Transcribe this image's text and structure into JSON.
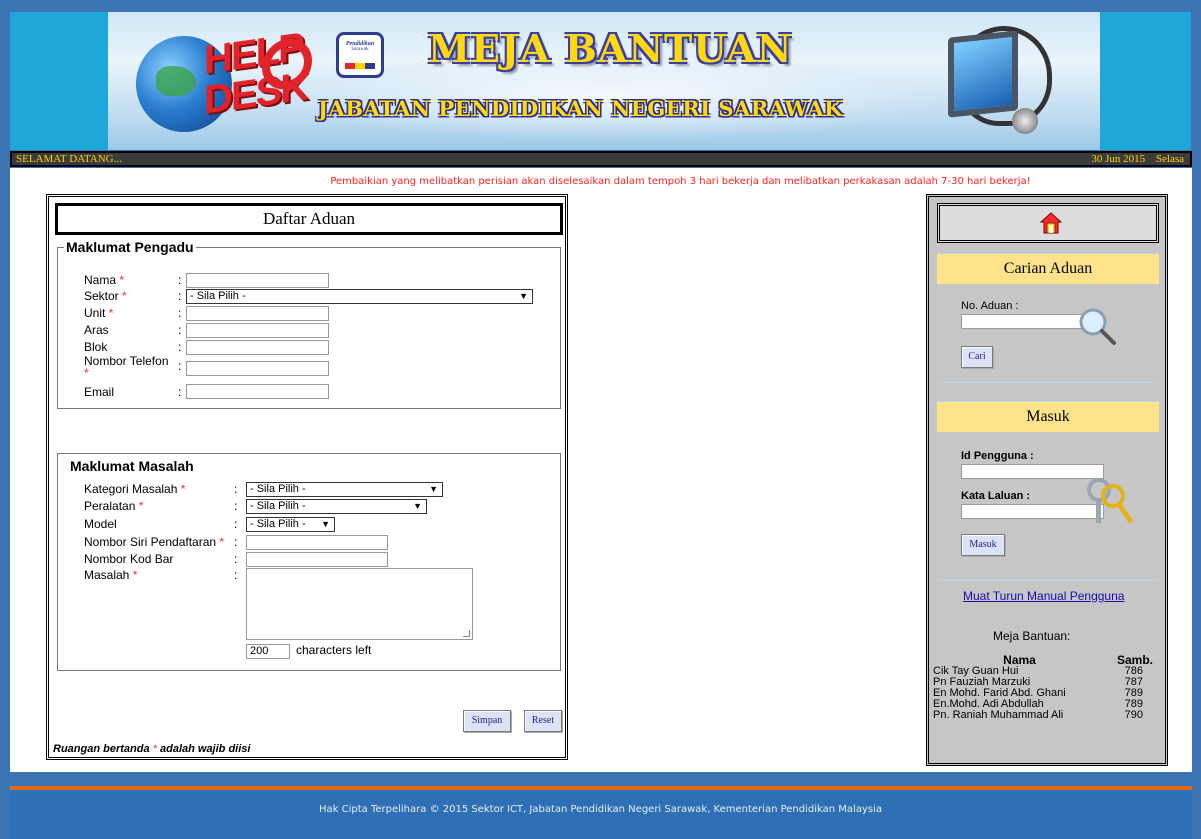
{
  "header": {
    "title": "MEJA BANTUAN",
    "subtitle": "JABATAN PENDIDIKAN NEGERI SARAWAK",
    "logo_text": "HELP DESK",
    "crest_text_1": "Pendidikan",
    "crest_text_2": "Sarawak"
  },
  "welcome": {
    "text": "SELAMAT DATANG...",
    "date": "30 Jun 2015",
    "day": "Selasa"
  },
  "notice": "Pembaikian yang melibatkan perisian akan diselesaikan dalam tempoh 3 hari bekerja dan melibatkan perkakasan adalah 7-30 hari bekerja!",
  "form": {
    "title": "Daftar Aduan",
    "pengadu": {
      "legend": "Maklumat Pengadu",
      "nama": "Nama",
      "sektor": "Sektor",
      "sektor_value": "- Sila Pilih -",
      "unit": "Unit",
      "aras": "Aras",
      "blok": "Blok",
      "telefon": "Nombor Telefon",
      "email": "Email"
    },
    "masalah": {
      "legend": "Maklumat Masalah",
      "kategori": "Kategori Masalah",
      "kategori_value": "- Sila Pilih -",
      "peralatan": "Peralatan",
      "peralatan_value": "- Sila Pilih -",
      "model": "Model",
      "model_value": "- Sila Pilih -",
      "siri": "Nombor Siri Pendaftaran",
      "kodbar": "Nombor Kod Bar",
      "masalah": "Masalah",
      "char_count": "200",
      "char_label": "characters left"
    },
    "colon": ":",
    "asterisk": "*",
    "save_label": "Simpan",
    "reset_label": "Reset",
    "footnote_pre": "Ruangan bertanda",
    "footnote_post": "adalah wajib diisi"
  },
  "sidebar": {
    "search": {
      "title": "Carian Aduan",
      "label": "No. Aduan :",
      "button": "Cari"
    },
    "login": {
      "title": "Masuk",
      "user_label": "Id Pengguna :",
      "pass_label": "Kata Laluan :",
      "button": "Masuk"
    },
    "manual_link": "Muat Turun Manual Pengguna",
    "helpdesk_title": "Meja Bantuan:",
    "staff_headers": [
      "Nama",
      "Samb."
    ],
    "staff": [
      {
        "name": "Cik Tay Guan Hui",
        "ext": "786"
      },
      {
        "name": "Pn Fauziah Marzuki",
        "ext": "787"
      },
      {
        "name": "En Mohd. Farid Abd. Ghani",
        "ext": "789"
      },
      {
        "name": "En.Mohd. Adi Abdullah",
        "ext": "789"
      },
      {
        "name": "Pn. Raniah Muhammad Ali",
        "ext": "790"
      }
    ]
  },
  "footer": "Hak Cipta Terpelihara © 2015 Sektor ICT, Jabatan Pendidikan Negeri Sarawak, Kementerian Pendidikan Malaysia",
  "colors": {
    "page_bg": "#3b73b3",
    "banner_side": "#1fa7d9",
    "title_yellow": "#ffd90d",
    "notice_red": "#ff2020",
    "panel_header": "#ffe38a",
    "footer_line": "#e06a1a"
  },
  "icons": [
    "home-icon",
    "magnifier-icon",
    "keys-icon",
    "dropdown-arrow-icon"
  ]
}
